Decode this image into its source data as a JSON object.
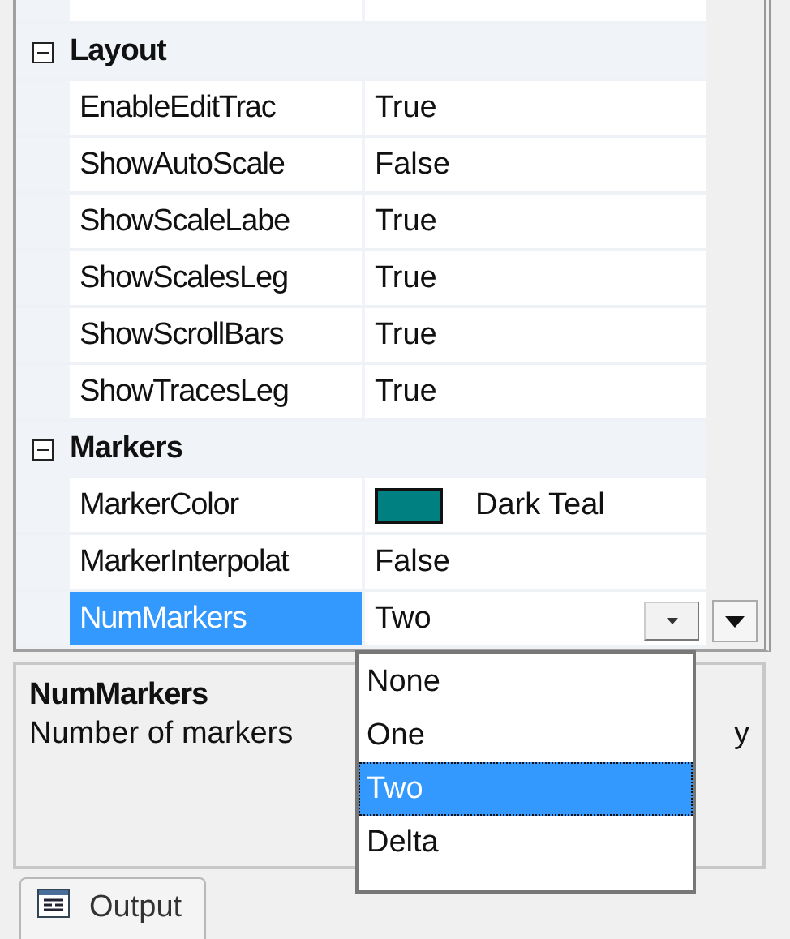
{
  "categories": [
    {
      "title": "Layout",
      "expanded": true,
      "properties": [
        {
          "kind": "text",
          "name": "EnableEditTrac",
          "value": "True",
          "selected": false
        },
        {
          "kind": "text",
          "name": "ShowAutoScale",
          "value": "False",
          "selected": false
        },
        {
          "kind": "text",
          "name": "ShowScaleLabe",
          "value": "True",
          "selected": false
        },
        {
          "kind": "text",
          "name": "ShowScalesLeg",
          "value": "True",
          "selected": false
        },
        {
          "kind": "text",
          "name": "ShowScrollBars",
          "value": "True",
          "selected": false
        },
        {
          "kind": "text",
          "name": "ShowTracesLeg",
          "value": "True",
          "selected": false
        }
      ]
    },
    {
      "title": "Markers",
      "expanded": true,
      "properties": [
        {
          "kind": "color",
          "name": "MarkerColor",
          "value": "Dark Teal",
          "color": "#008080",
          "selected": false
        },
        {
          "kind": "text",
          "name": "MarkerInterpolat",
          "value": "False",
          "selected": false
        },
        {
          "kind": "dropdown",
          "name": "NumMarkers",
          "value": "Two",
          "selected": true
        }
      ]
    }
  ],
  "dropdown_options": [
    {
      "label": "None",
      "selected": false
    },
    {
      "label": "One",
      "selected": false
    },
    {
      "label": "Two",
      "selected": true
    },
    {
      "label": "Delta",
      "selected": false
    }
  ],
  "description": {
    "title": "NumMarkers",
    "text_start": "Number of markers",
    "text_end": "y"
  },
  "bottom_tabs": [
    {
      "label": "Output",
      "selected": false
    }
  ]
}
